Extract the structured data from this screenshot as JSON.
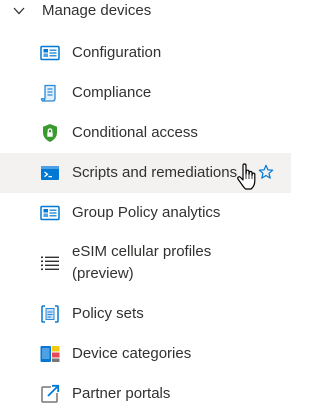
{
  "group": {
    "title": "Manage devices",
    "icon": "chevron-down-icon",
    "expanded": true
  },
  "items": [
    {
      "label": "Configuration",
      "icon": "device-configuration-icon"
    },
    {
      "label": "Compliance",
      "icon": "compliance-scroll-icon"
    },
    {
      "label": "Conditional access",
      "icon": "shield-lock-icon"
    },
    {
      "label": "Scripts and remediations",
      "icon": "terminal-script-icon",
      "hovered": true,
      "favorite_icon": "star-outline-icon"
    },
    {
      "label": "Group Policy analytics",
      "icon": "group-policy-analytics-icon"
    },
    {
      "label": "eSIM cellular profiles",
      "label_line2": "(preview)",
      "icon": "esim-list-icon"
    },
    {
      "label": "Policy sets",
      "icon": "policy-sets-icon"
    },
    {
      "label": "Device categories",
      "icon": "device-categories-icon"
    },
    {
      "label": "Partner portals",
      "icon": "partner-portal-link-icon"
    }
  ],
  "colors": {
    "accent": "#0078d4",
    "active_background": "#f3f2f1",
    "text": "#323130",
    "shield_green": "#3a9a30"
  }
}
